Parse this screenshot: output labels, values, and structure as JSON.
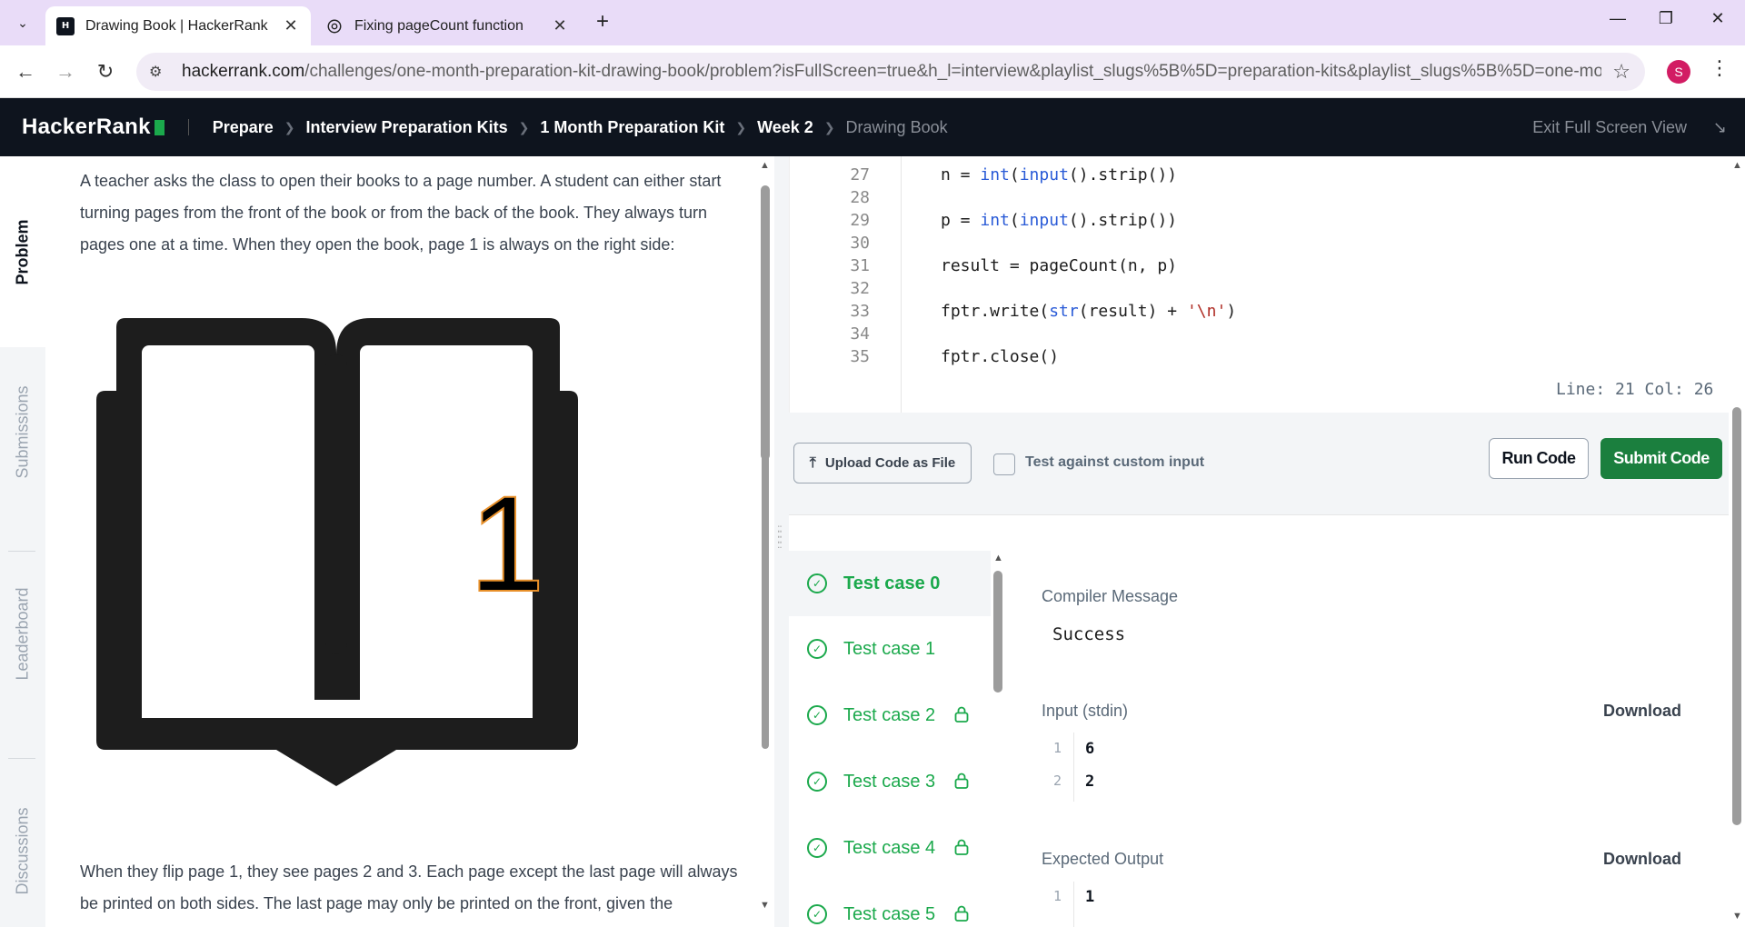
{
  "browser": {
    "tabs": [
      {
        "title": "Drawing Book | HackerRank",
        "favicon": "hackerrank-favicon"
      },
      {
        "title": "Fixing pageCount function",
        "favicon": "chatgpt-favicon"
      }
    ],
    "url_host": "hackerrank.com",
    "url_path": "/challenges/one-month-preparation-kit-drawing-book/problem?isFullScreen=true&h_l=interview&playlist_slugs%5B%5D=preparation-kits&playlist_slugs%5B%5D=one-month-preparat...",
    "profile_initial": "S"
  },
  "header": {
    "logo": "HackerRank",
    "breadcrumbs": [
      "Prepare",
      "Interview Preparation Kits",
      "1 Month Preparation Kit",
      "Week 2",
      "Drawing Book"
    ],
    "exit_fullscreen": "Exit Full Screen View"
  },
  "side_tabs": [
    "Problem",
    "Submissions",
    "Leaderboard",
    "Discussions"
  ],
  "problem": {
    "para1": "A teacher asks the class to open their books to a page number. A student can either start turning pages from the front of the book or from the back of the book. They always turn pages one at a time. When they open the book, page 1 is always on the right side:",
    "book_page_number": "1",
    "para2": "When they flip page 1, they see pages 2 and 3. Each page except the last page will always be printed on both sides. The last page may only be printed on the front, given the"
  },
  "editor": {
    "lines": [
      {
        "n": "27",
        "code": "n = int(input().strip())"
      },
      {
        "n": "28",
        "code": ""
      },
      {
        "n": "29",
        "code": "p = int(input().strip())"
      },
      {
        "n": "30",
        "code": ""
      },
      {
        "n": "31",
        "code": "result = pageCount(n, p)"
      },
      {
        "n": "32",
        "code": ""
      },
      {
        "n": "33",
        "code": "fptr.write(str(result) + '\\n')"
      },
      {
        "n": "34",
        "code": ""
      },
      {
        "n": "35",
        "code": "fptr.close()"
      }
    ],
    "cursor_position": "Line: 21 Col: 26"
  },
  "actions": {
    "upload": "Upload Code as File",
    "custom_input": "Test against custom input",
    "run": "Run Code",
    "submit": "Submit Code"
  },
  "results": {
    "test_cases": [
      {
        "label": "Test case 0",
        "locked": false
      },
      {
        "label": "Test case 1",
        "locked": false
      },
      {
        "label": "Test case 2",
        "locked": true
      },
      {
        "label": "Test case 3",
        "locked": true
      },
      {
        "label": "Test case 4",
        "locked": true
      },
      {
        "label": "Test case 5",
        "locked": true
      }
    ],
    "compiler_message_label": "Compiler Message",
    "compiler_message": "Success",
    "input_label": "Input (stdin)",
    "input_lines": [
      {
        "n": "1",
        "v": "6"
      },
      {
        "n": "2",
        "v": "2"
      }
    ],
    "expected_label": "Expected Output",
    "expected_lines": [
      {
        "n": "1",
        "v": "1"
      }
    ],
    "download": "Download"
  },
  "colors": {
    "brand_green": "#1ba94c",
    "submit_green": "#1b7f3e",
    "header_bg": "#0e141e",
    "tabbar_bg": "#e9dcf8"
  }
}
